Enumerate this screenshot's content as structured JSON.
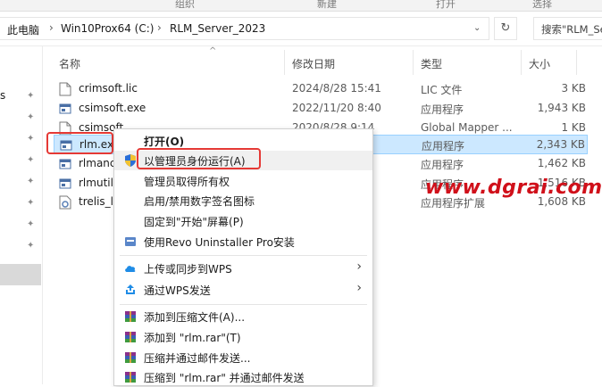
{
  "toolbar_strip": [
    "组织",
    "新建",
    "打开",
    "选择"
  ],
  "address": {
    "crumbs": [
      "此电脑",
      "Win10Prox64 (C:)",
      "RLM_Server_2023"
    ],
    "search_placeholder": "搜索\"RLM_Se"
  },
  "nav": {
    "partial_label": "s"
  },
  "columns": {
    "name": "名称",
    "date": "修改日期",
    "type": "类型",
    "size": "大小"
  },
  "files": [
    {
      "name": "crimsoft.lic",
      "date": "2024/8/28 15:41",
      "type": "LIC 文件",
      "size": "3 KB",
      "icon": "doc-icon"
    },
    {
      "name": "csimsoft.exe",
      "date": "2022/11/20 8:40",
      "type": "应用程序",
      "size": "1,943 KB",
      "icon": "exe-icon"
    },
    {
      "name": "csimsoft.",
      "date": "2020/8/28 9:14",
      "type": "Global Mapper ...",
      "size": "1 KB",
      "icon": "doc-icon"
    },
    {
      "name": "rlm.exe",
      "date": "1",
      "type": "应用程序",
      "size": "2,343 KB",
      "icon": "exe-icon"
    },
    {
      "name": "rlmanc",
      "date": "5",
      "type": "应用程序",
      "size": "1,462 KB",
      "icon": "exe-icon"
    },
    {
      "name": "rlmutil.",
      "date": "5",
      "type": "应用程序",
      "size": "1,516 KB",
      "icon": "exe-icon"
    },
    {
      "name": "trelis_l",
      "date": "3",
      "type": "应用程序扩展",
      "size": "1,608 KB",
      "icon": "dll-icon"
    }
  ],
  "context_menu": {
    "open": "打开(O)",
    "run_as_admin": "以管理员身份运行(A)",
    "take_ownership": "管理员取得所有权",
    "toggle_signature": "启用/禁用数字签名图标",
    "pin_start": "固定到\"开始\"屏幕(P)",
    "revo": "使用Revo Uninstaller Pro安装",
    "wps_upload": "上传或同步到WPS",
    "wps_send": "通过WPS发送",
    "rar_add": "添加到压缩文件(A)...",
    "rar_add_named": "添加到 \"rlm.rar\"(T)",
    "rar_compress_email": "压缩并通过邮件发送...",
    "rar_compress_named_email": "压缩到 \"rlm.rar\" 并通过邮件发送"
  },
  "watermark": "www.dgrai.com",
  "colors": {
    "selection": "#cce8ff",
    "highlight": "#e53935",
    "watermark": "#d0101a"
  }
}
